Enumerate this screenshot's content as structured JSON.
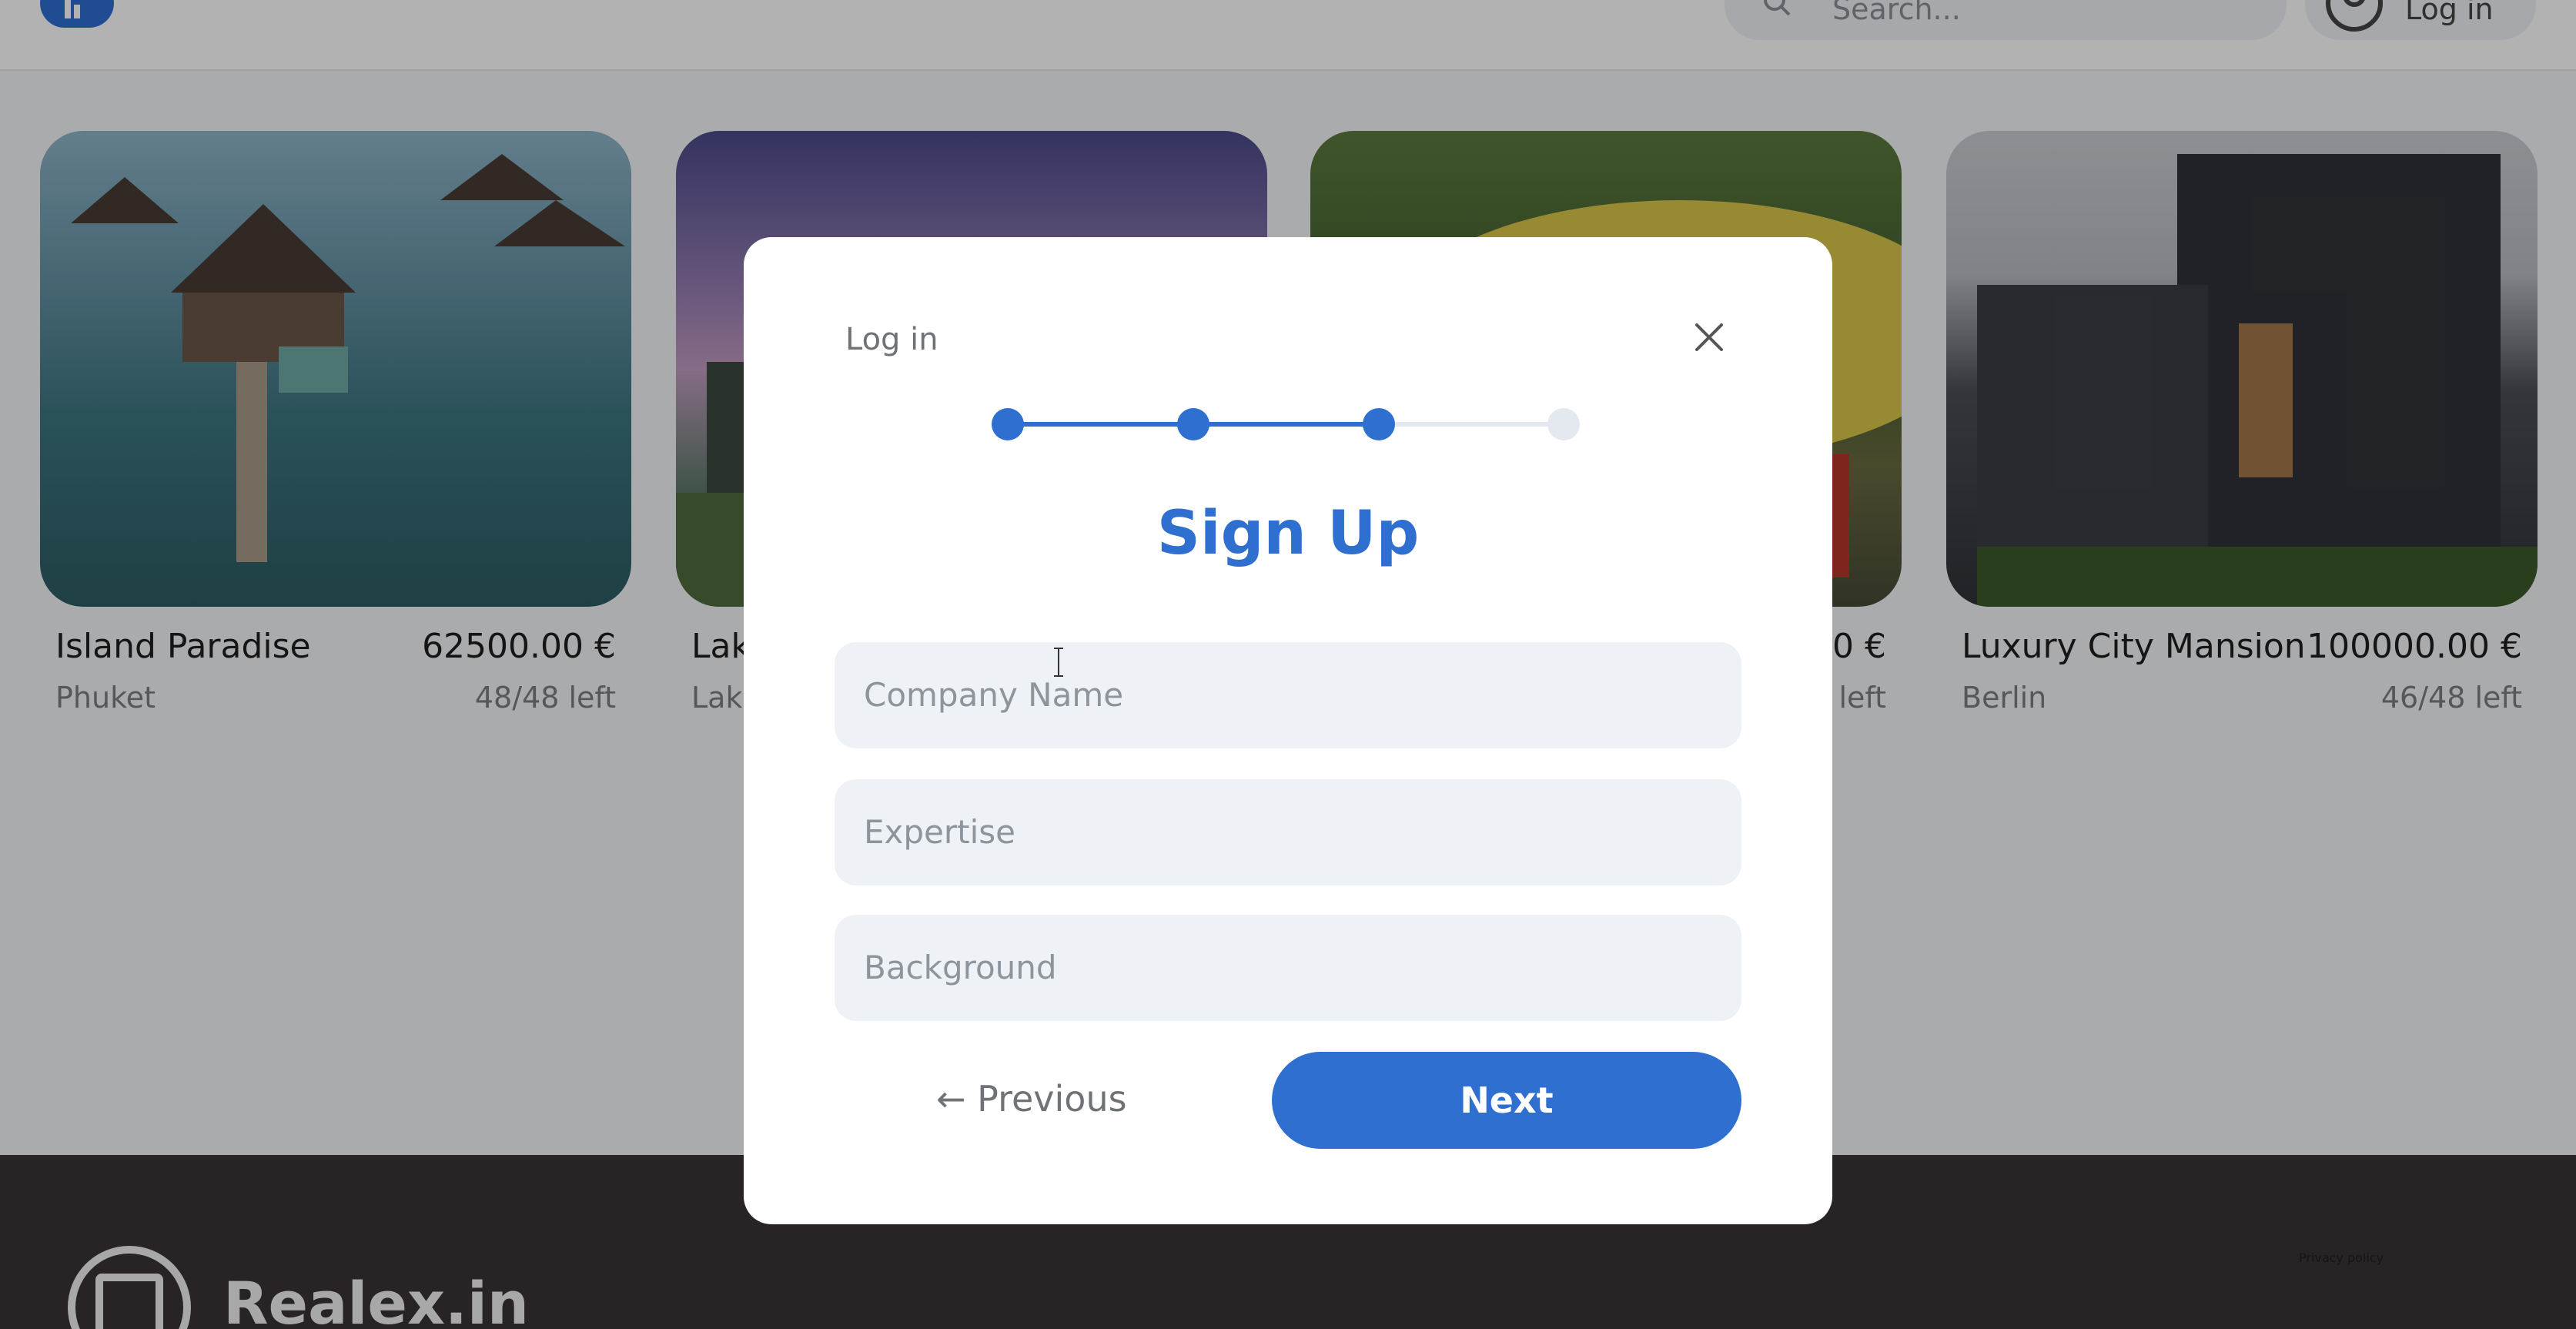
{
  "header": {
    "search_placeholder": "Search...",
    "login_label": "Log in"
  },
  "listings": [
    {
      "title": "Island Paradise",
      "price": "62500.00 €",
      "location": "Phuket",
      "availability": "48/48 left"
    },
    {
      "title": "Lak",
      "price": "",
      "location": "Lak",
      "availability": ""
    },
    {
      "title": "",
      "price": "0 €",
      "location": "",
      "availability": "left"
    },
    {
      "title": "Luxury City Mansion",
      "price": "100000.00 €",
      "location": "Berlin",
      "availability": "46/48 left"
    }
  ],
  "modal": {
    "login_link": "Log in",
    "title": "Sign Up",
    "steps": {
      "total": 4,
      "completed": 3
    },
    "fields": [
      {
        "placeholder": "Company Name"
      },
      {
        "placeholder": "Expertise"
      },
      {
        "placeholder": "Background"
      }
    ],
    "previous_label": "← Previous",
    "next_label": "Next"
  },
  "footer": {
    "brand": "Realex.in",
    "privacy": "Privacy policy"
  },
  "colors": {
    "accent": "#2f6fd0",
    "field_bg": "#eef2f6",
    "step_inactive": "#e4e9ef",
    "footer_bg": "#3a3435"
  }
}
